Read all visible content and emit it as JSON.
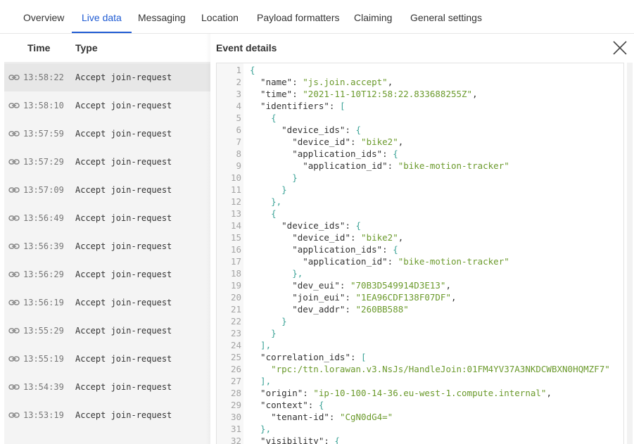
{
  "tabs": [
    {
      "label": "Overview",
      "active": false
    },
    {
      "label": "Live data",
      "active": true
    },
    {
      "label": "Messaging",
      "active": false
    },
    {
      "label": "Location",
      "active": false
    },
    {
      "label": "Payload formatters",
      "active": false
    },
    {
      "label": "Claiming",
      "active": false
    },
    {
      "label": "General settings",
      "active": false
    }
  ],
  "event_list": {
    "headers": {
      "time": "Time",
      "type": "Type"
    },
    "row_icon": "link-icon",
    "rows": [
      {
        "time": "13:58:22",
        "type": "Accept join-request",
        "selected": true
      },
      {
        "time": "13:58:10",
        "type": "Accept join-request",
        "selected": false
      },
      {
        "time": "13:57:59",
        "type": "Accept join-request",
        "selected": false
      },
      {
        "time": "13:57:29",
        "type": "Accept join-request",
        "selected": false
      },
      {
        "time": "13:57:09",
        "type": "Accept join-request",
        "selected": false
      },
      {
        "time": "13:56:49",
        "type": "Accept join-request",
        "selected": false
      },
      {
        "time": "13:56:39",
        "type": "Accept join-request",
        "selected": false
      },
      {
        "time": "13:56:29",
        "type": "Accept join-request",
        "selected": false
      },
      {
        "time": "13:56:19",
        "type": "Accept join-request",
        "selected": false
      },
      {
        "time": "13:55:29",
        "type": "Accept join-request",
        "selected": false
      },
      {
        "time": "13:55:19",
        "type": "Accept join-request",
        "selected": false
      },
      {
        "time": "13:54:39",
        "type": "Accept join-request",
        "selected": false
      },
      {
        "time": "13:53:19",
        "type": "Accept join-request",
        "selected": false
      }
    ]
  },
  "event_details": {
    "title": "Event details",
    "close_icon": "close-icon",
    "lines": [
      [
        [
          "p",
          "{"
        ]
      ],
      [
        [
          "k",
          "  \"name\": "
        ],
        [
          "s",
          "\"js.join.accept\""
        ],
        [
          "k",
          ","
        ]
      ],
      [
        [
          "k",
          "  \"time\": "
        ],
        [
          "s",
          "\"2021-11-10T12:58:22.833688255Z\""
        ],
        [
          "k",
          ","
        ]
      ],
      [
        [
          "k",
          "  \"identifiers\": "
        ],
        [
          "p",
          "["
        ]
      ],
      [
        [
          "p",
          "    {"
        ]
      ],
      [
        [
          "k",
          "      \"device_ids\": "
        ],
        [
          "p",
          "{"
        ]
      ],
      [
        [
          "k",
          "        \"device_id\": "
        ],
        [
          "s",
          "\"bike2\""
        ],
        [
          "k",
          ","
        ]
      ],
      [
        [
          "k",
          "        \"application_ids\": "
        ],
        [
          "p",
          "{"
        ]
      ],
      [
        [
          "k",
          "          \"application_id\": "
        ],
        [
          "s",
          "\"bike-motion-tracker\""
        ]
      ],
      [
        [
          "p",
          "        }"
        ]
      ],
      [
        [
          "p",
          "      }"
        ]
      ],
      [
        [
          "p",
          "    },"
        ]
      ],
      [
        [
          "p",
          "    {"
        ]
      ],
      [
        [
          "k",
          "      \"device_ids\": "
        ],
        [
          "p",
          "{"
        ]
      ],
      [
        [
          "k",
          "        \"device_id\": "
        ],
        [
          "s",
          "\"bike2\""
        ],
        [
          "k",
          ","
        ]
      ],
      [
        [
          "k",
          "        \"application_ids\": "
        ],
        [
          "p",
          "{"
        ]
      ],
      [
        [
          "k",
          "          \"application_id\": "
        ],
        [
          "s",
          "\"bike-motion-tracker\""
        ]
      ],
      [
        [
          "p",
          "        },"
        ]
      ],
      [
        [
          "k",
          "        \"dev_eui\": "
        ],
        [
          "s",
          "\"70B3D549914D3E13\""
        ],
        [
          "k",
          ","
        ]
      ],
      [
        [
          "k",
          "        \"join_eui\": "
        ],
        [
          "s",
          "\"1EA96CDF138F07DF\""
        ],
        [
          "k",
          ","
        ]
      ],
      [
        [
          "k",
          "        \"dev_addr\": "
        ],
        [
          "s",
          "\"260BB588\""
        ]
      ],
      [
        [
          "p",
          "      }"
        ]
      ],
      [
        [
          "p",
          "    }"
        ]
      ],
      [
        [
          "p",
          "  ],"
        ]
      ],
      [
        [
          "k",
          "  \"correlation_ids\": "
        ],
        [
          "p",
          "["
        ]
      ],
      [
        [
          "s",
          "    \"rpc:/ttn.lorawan.v3.NsJs/HandleJoin:01FM4YV37A3NKDCWBXN0HQMZF7\""
        ]
      ],
      [
        [
          "p",
          "  ],"
        ]
      ],
      [
        [
          "k",
          "  \"origin\": "
        ],
        [
          "s",
          "\"ip-10-100-14-36.eu-west-1.compute.internal\""
        ],
        [
          "k",
          ","
        ]
      ],
      [
        [
          "k",
          "  \"context\": "
        ],
        [
          "p",
          "{"
        ]
      ],
      [
        [
          "k",
          "    \"tenant-id\": "
        ],
        [
          "s",
          "\"CgN0dG4=\""
        ]
      ],
      [
        [
          "p",
          "  },"
        ]
      ],
      [
        [
          "k",
          "  \"visibility\": "
        ],
        [
          "p",
          "{"
        ]
      ]
    ]
  }
}
